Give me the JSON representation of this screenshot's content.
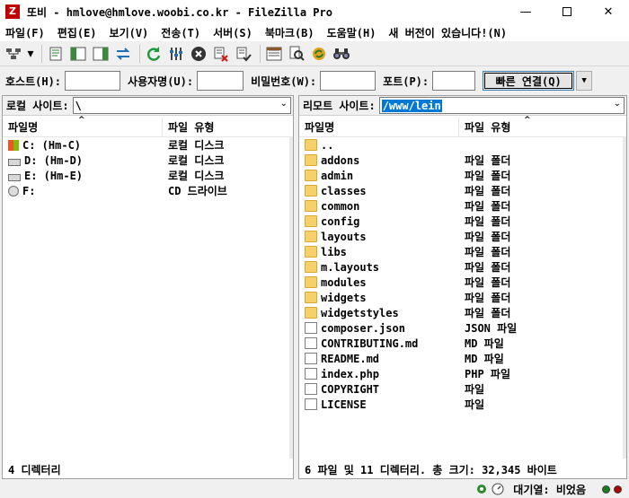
{
  "window": {
    "title": "또비 - hmlove@hmlove.woobi.co.kr - FileZilla Pro",
    "minimize": "—",
    "close": "✕"
  },
  "menu": {
    "items": [
      "파일(F)",
      "편집(E)",
      "보기(V)",
      "전송(T)",
      "서버(S)",
      "북마크(B)",
      "도움말(H)",
      "새 버전이 있습니다!(N)"
    ]
  },
  "toolbar": {
    "icons": [
      "site-manager-icon",
      "dropdown-icon",
      "message-log-icon",
      "local-tree-icon",
      "remote-tree-icon",
      "transfer-queue-icon",
      "refresh-icon",
      "process-queue-icon",
      "cancel-icon",
      "disconnect-icon",
      "reconnect-icon",
      "directory-listing-filter-icon",
      "search-icon",
      "sync-browse-icon",
      "binoculars-icon"
    ]
  },
  "quickconnect": {
    "host_label": "호스트(H):",
    "user_label": "사용자명(U):",
    "pass_label": "비밀번호(W):",
    "port_label": "포트(P):",
    "button_label": "빠른 연결(Q)",
    "dropdown": "▼"
  },
  "local": {
    "site_label": "로컬 사이트:",
    "path": "\\",
    "col_name": "파일명",
    "col_type": "파일 유형",
    "rows": [
      {
        "name": "C: (Hm-C)",
        "type": "로컬 디스크",
        "icon": "windows-drive-icon"
      },
      {
        "name": "D: (Hm-D)",
        "type": "로컬 디스크",
        "icon": "drive-icon"
      },
      {
        "name": "E: (Hm-E)",
        "type": "로컬 디스크",
        "icon": "drive-icon"
      },
      {
        "name": "F:",
        "type": "CD 드라이브",
        "icon": "cd-drive-icon"
      }
    ],
    "status": "4 디렉터리"
  },
  "remote": {
    "site_label": "리모트 사이트:",
    "path": "/www/lein",
    "col_name": "파일명",
    "col_type": "파일 유형",
    "rows": [
      {
        "name": "..",
        "type": "",
        "icon": "folder-icon"
      },
      {
        "name": "addons",
        "type": "파일 폴더",
        "icon": "folder-icon"
      },
      {
        "name": "admin",
        "type": "파일 폴더",
        "icon": "folder-icon"
      },
      {
        "name": "classes",
        "type": "파일 폴더",
        "icon": "folder-icon"
      },
      {
        "name": "common",
        "type": "파일 폴더",
        "icon": "folder-icon"
      },
      {
        "name": "config",
        "type": "파일 폴더",
        "icon": "folder-icon"
      },
      {
        "name": "layouts",
        "type": "파일 폴더",
        "icon": "folder-icon"
      },
      {
        "name": "libs",
        "type": "파일 폴더",
        "icon": "folder-icon"
      },
      {
        "name": "m.layouts",
        "type": "파일 폴더",
        "icon": "folder-icon"
      },
      {
        "name": "modules",
        "type": "파일 폴더",
        "icon": "folder-icon"
      },
      {
        "name": "widgets",
        "type": "파일 폴더",
        "icon": "folder-icon"
      },
      {
        "name": "widgetstyles",
        "type": "파일 폴더",
        "icon": "folder-icon"
      },
      {
        "name": "composer.json",
        "type": "JSON 파일",
        "icon": "file-icon"
      },
      {
        "name": "CONTRIBUTING.md",
        "type": "MD 파일",
        "icon": "file-icon"
      },
      {
        "name": "README.md",
        "type": "MD 파일",
        "icon": "file-icon"
      },
      {
        "name": "index.php",
        "type": "PHP 파일",
        "icon": "file-icon"
      },
      {
        "name": "COPYRIGHT",
        "type": "파일",
        "icon": "file-icon"
      },
      {
        "name": "LICENSE",
        "type": "파일",
        "icon": "file-icon"
      }
    ],
    "status": "6 파일 및 11 디렉터리. 총 크기: 32,345 바이트"
  },
  "bottom": {
    "queue_label": "대기열: 비었음",
    "led_colors": [
      "#1a7f1a",
      "#b00000"
    ]
  }
}
